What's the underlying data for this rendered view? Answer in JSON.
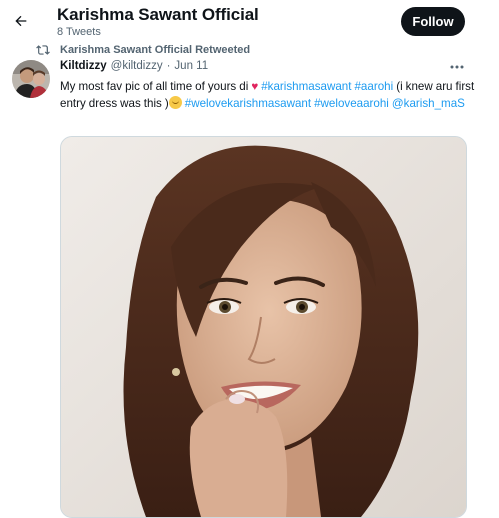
{
  "header": {
    "title": "Karishma Sawant Official",
    "tweet_count": "8 Tweets",
    "follow_label": "Follow"
  },
  "retweet": {
    "label": "Karishma Sawant Official Retweeted"
  },
  "tweet": {
    "author_name": "Kiltdizzy",
    "author_handle": "@kiltdizzy",
    "separator": "·",
    "date": "Jun 11",
    "text_part1": "My most fav pic of all time of yours di",
    "hashtag1": "#karishmasawant",
    "hashtag2": "#aarohi",
    "text_part2": "(i knew aru first entry dress was this )",
    "hashtag3": "#welovekarishmasawant",
    "hashtag4": "#weloveaarohi",
    "mention": "@karish_maS"
  },
  "icons": {
    "back": "arrow-left-icon",
    "retweet": "retweet-icon",
    "more": "more-horizontal-icon",
    "heart_emoji": "red-heart-emoji",
    "hug_emoji": "hugging-face-emoji"
  },
  "colors": {
    "link": "#1d9bf0",
    "secondary_text": "#536471",
    "primary_text": "#0f1419",
    "follow_bg": "#0f1419",
    "heart": "#e0245e"
  }
}
